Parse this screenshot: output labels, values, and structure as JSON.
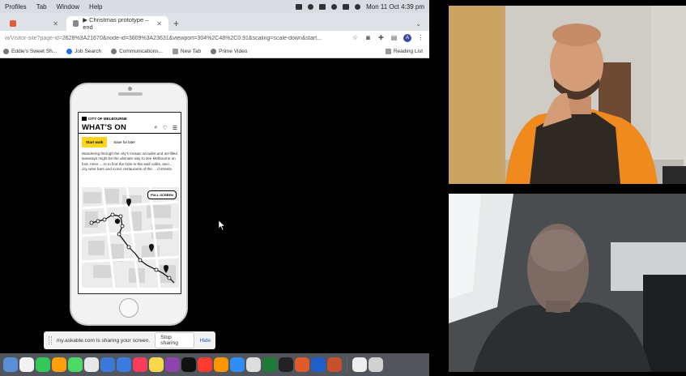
{
  "menubar": {
    "items": [
      "Profiles",
      "Tab",
      "Window",
      "Help"
    ],
    "clock": "Mon 11 Oct  4:39 pm"
  },
  "browser": {
    "tabs": [
      {
        "label": "",
        "favicon_color": "#e25a3a",
        "active": false
      },
      {
        "label": "▶ Christmas prototype – end",
        "favicon": "figma-icon",
        "active": true
      }
    ],
    "new_tab": "+",
    "tab_menu": "⌄",
    "url_dim": "w/Visitor-site?page-id=",
    "url": "2628%3A21670&node-id=3609%3A23631&viewport=304%2C48%2C0.91&scaling=scale-down&start...",
    "avatar_letter": "A",
    "bookmarks": [
      {
        "label": "Eddie's Sweet Sh...",
        "icon": "globe-icon"
      },
      {
        "label": "Job Search",
        "icon": "seek-icon"
      },
      {
        "label": "Communications...",
        "icon": "globe-icon"
      },
      {
        "label": "New Tab",
        "icon": "page-icon"
      },
      {
        "label": "Prime Video",
        "icon": "globe-icon"
      }
    ],
    "reading_list": "Reading List"
  },
  "prototype": {
    "org": "CITY OF MELBOURNE",
    "title": "WHAT'S ON",
    "start_walk": "Start walk",
    "save_for_later": "Save for later",
    "description": "Wandering through the city's mosaic arcades and art-filled laneways might be the ultimate way to see Melbourne on foot. Here ... re to find the hole-in-the-wall cafés, secr... city wine bars and iconic restaurants of the ... d streets.",
    "full_screen": "FULL SCREEN"
  },
  "share_bar": {
    "message": "my.askable.com is sharing your screen.",
    "stop": "Stop sharing",
    "hide": "Hide"
  },
  "dock": {
    "apps": [
      "#5a8fd8",
      "#f2f2f2",
      "#34c759",
      "#ff9f0a",
      "#4cd964",
      "#e8e8e8",
      "#3c78d8",
      "#3b7be0",
      "#fb3c5c",
      "#f9d74c",
      "#8e44ad",
      "#111111",
      "#ff3b30",
      "#ff9500",
      "#2f8ef6",
      "#dddddd",
      "#1f7a3a",
      "#222222",
      "#e05a2b",
      "#1e5fc9",
      "#c9502c",
      "#eeeeee",
      "#d0d0d0"
    ]
  },
  "colors": {
    "accent_yellow": "#ffd61f",
    "menubar_bg": "#d9dde3",
    "chrome_bg": "#dee1e6"
  }
}
